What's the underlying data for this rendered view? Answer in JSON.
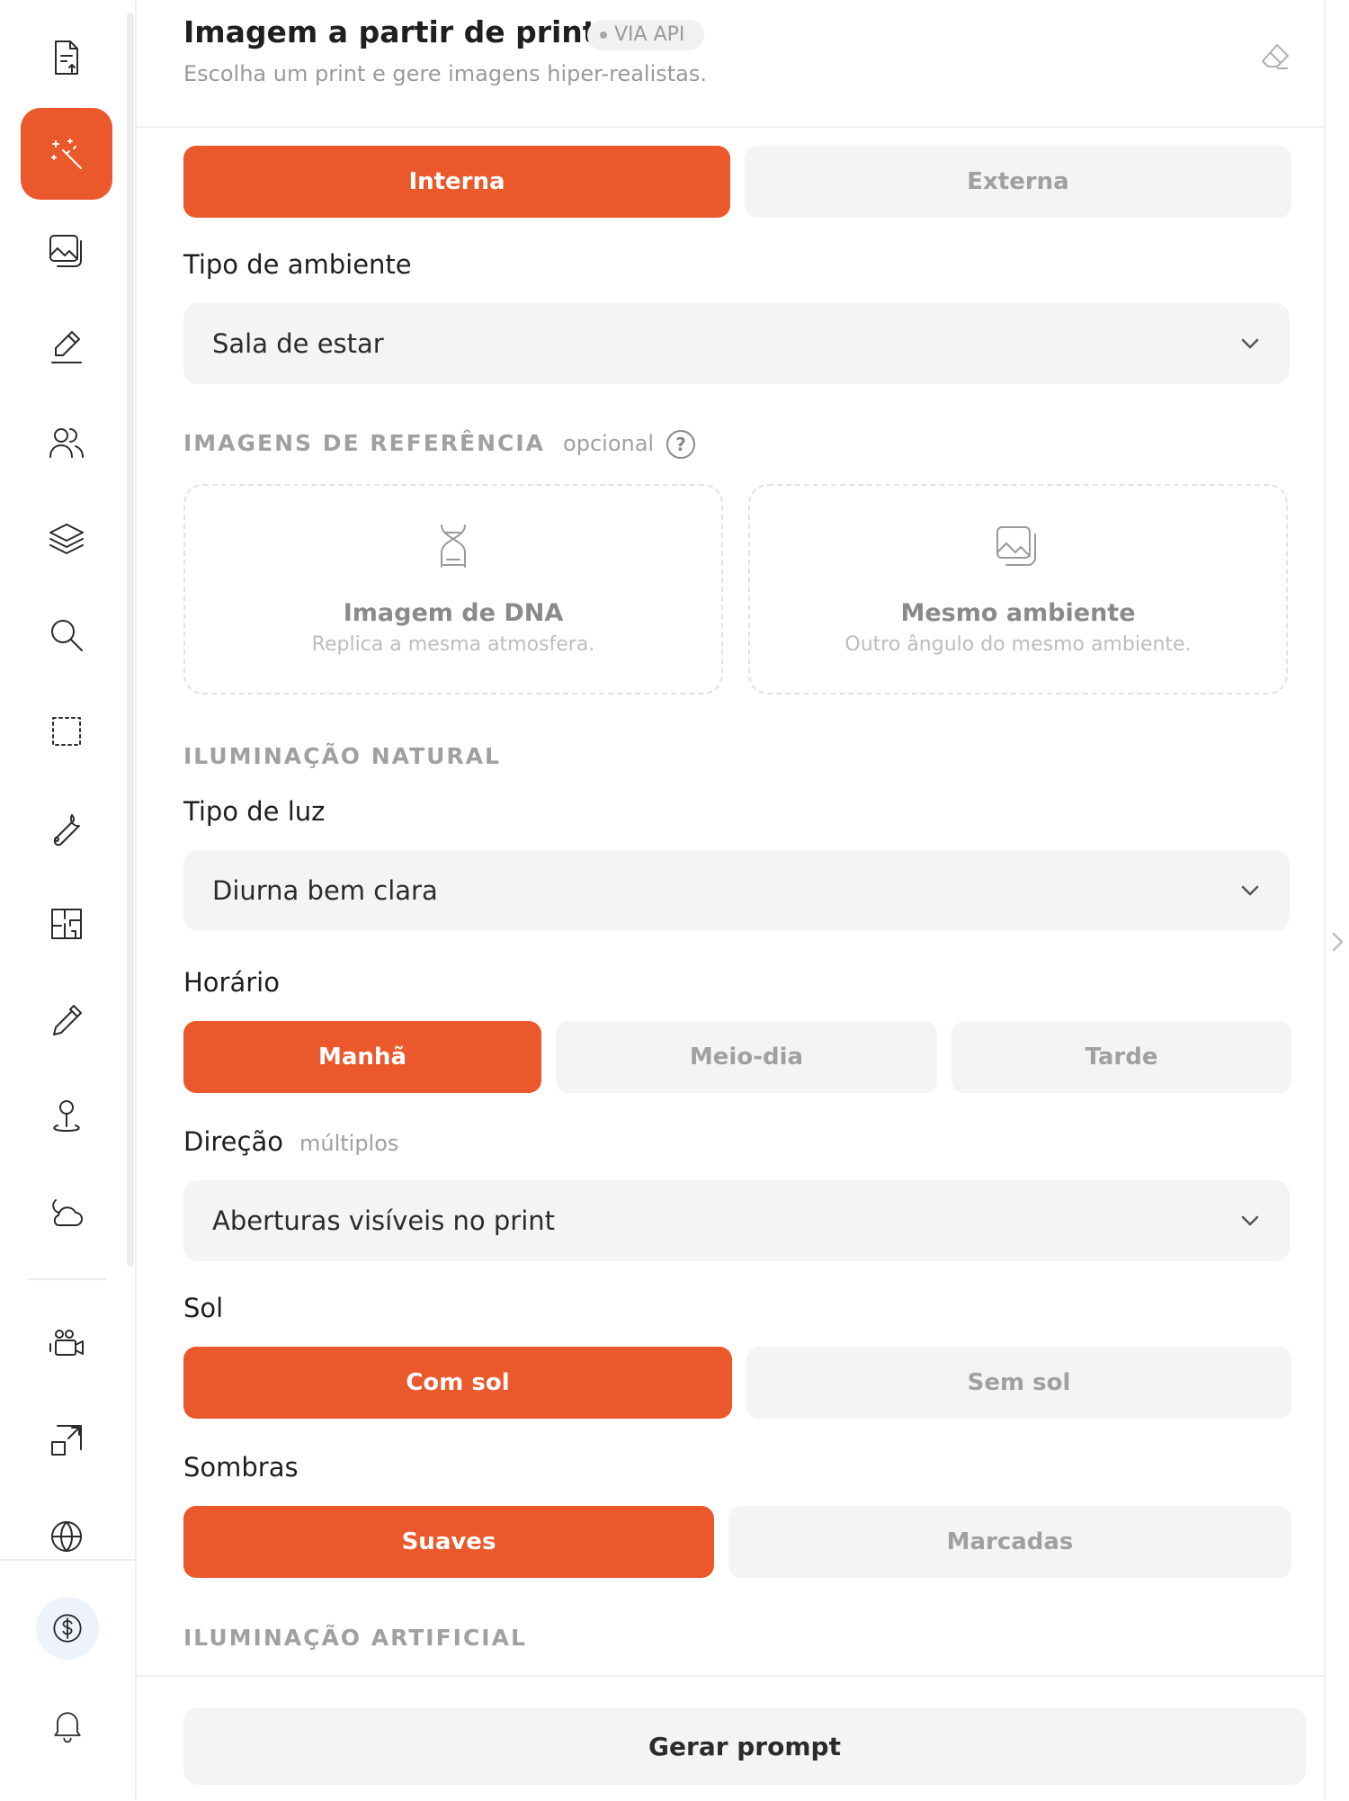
{
  "header": {
    "title": "Imagem a partir de print",
    "badge": "VIA API",
    "subtitle": "Escolha um print e gere imagens hiper-realistas."
  },
  "environment_tabs": {
    "options": [
      "Interna",
      "Externa"
    ],
    "selected": "Interna"
  },
  "tipo_ambiente": {
    "label": "Tipo de ambiente",
    "value": "Sala de estar"
  },
  "referencias": {
    "title": "IMAGENS DE REFERÊNCIA",
    "hint": "opcional",
    "help": "?",
    "cards": [
      {
        "title": "Imagem de DNA",
        "subtitle": "Replica a mesma atmosfera.",
        "icon": "dna-icon"
      },
      {
        "title": "Mesmo ambiente",
        "subtitle": "Outro ângulo do mesmo ambiente.",
        "icon": "images-icon"
      }
    ]
  },
  "iluminacao_natural": {
    "title": "ILUMINAÇÃO NATURAL",
    "tipo_luz": {
      "label": "Tipo de luz",
      "value": "Diurna bem clara"
    },
    "horario": {
      "label": "Horário",
      "options": [
        "Manhã",
        "Meio-dia",
        "Tarde"
      ],
      "selected": "Manhã"
    },
    "direcao": {
      "label": "Direção",
      "hint": "múltiplos",
      "value": "Aberturas visíveis no print"
    },
    "sol": {
      "label": "Sol",
      "options": [
        "Com sol",
        "Sem sol"
      ],
      "selected": "Com sol"
    },
    "sombras": {
      "label": "Sombras",
      "options": [
        "Suaves",
        "Marcadas"
      ],
      "selected": "Suaves"
    }
  },
  "iluminacao_artificial": {
    "title": "ILUMINAÇÃO ARTIFICIAL"
  },
  "footer": {
    "generate_label": "Gerar prompt"
  },
  "sidebar": {
    "items": [
      "file-upload-icon",
      "magic-wand-icon",
      "images-icon",
      "pencil-icon",
      "users-icon",
      "layers-icon",
      "search-icon",
      "selection-icon",
      "wrench-icon",
      "floor-plan-icon",
      "eyedropper-icon",
      "map-pin-icon",
      "cloud-sun-icon",
      "video-camera-icon",
      "resize-icon",
      "globe-icon"
    ],
    "active": "magic-wand-icon",
    "bottom": [
      "dollar-coin-icon",
      "bell-icon"
    ]
  },
  "colors": {
    "accent": "#eb582b",
    "inactive_bg": "#f4f4f4",
    "muted_text": "#a0a0a0"
  }
}
